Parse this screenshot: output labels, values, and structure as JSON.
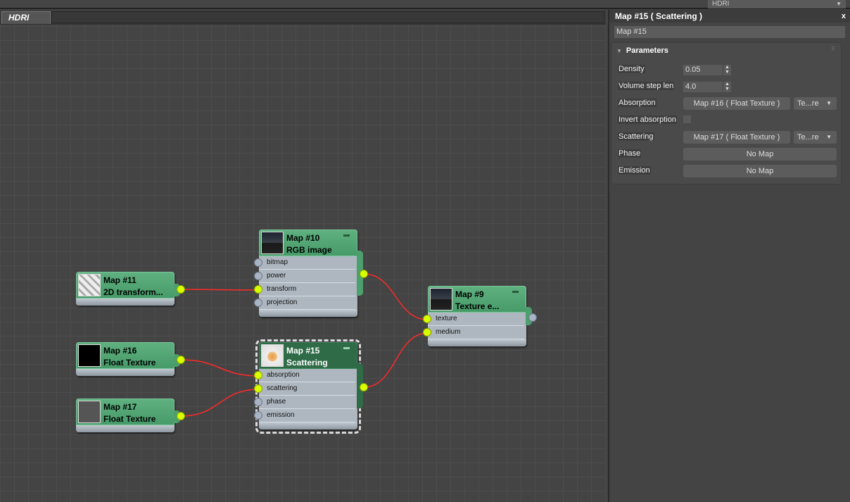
{
  "top_dropdown": {
    "value": "HDRI"
  },
  "view": {
    "tab": "HDRI"
  },
  "nodes": [
    {
      "id": "n11",
      "name": "Map #11",
      "type": "2D transform...",
      "thumb": "transform",
      "inputs": [],
      "output": "on"
    },
    {
      "id": "n10",
      "name": "Map #10",
      "type": "RGB image",
      "thumb": "hdri",
      "inputs": [
        {
          "label": "bitmap",
          "on": false
        },
        {
          "label": "power",
          "on": false
        },
        {
          "label": "transform",
          "on": true
        },
        {
          "label": "projection",
          "on": false
        }
      ],
      "output": "on"
    },
    {
      "id": "n9",
      "name": "Map #9",
      "type": "Texture e...",
      "thumb": "hdri",
      "inputs": [
        {
          "label": "texture",
          "on": true
        },
        {
          "label": "medium",
          "on": true
        }
      ],
      "output": "off"
    },
    {
      "id": "n16",
      "name": "Map #16",
      "type": "Float Texture",
      "thumb": "black",
      "inputs": [],
      "output": "on"
    },
    {
      "id": "n17",
      "name": "Map #17",
      "type": "Float Texture",
      "thumb": "gray",
      "inputs": [],
      "output": "on"
    },
    {
      "id": "n15",
      "name": "Map #15",
      "type": "Scattering",
      "thumb": "sphere",
      "selected": true,
      "inputs": [
        {
          "label": "absorption",
          "on": true
        },
        {
          "label": "scattering",
          "on": true
        },
        {
          "label": "phase",
          "on": false
        },
        {
          "label": "emission",
          "on": false
        }
      ],
      "output": "on"
    }
  ],
  "wires": [
    [
      "n11",
      "n10",
      "transform"
    ],
    [
      "n10",
      "n9",
      "texture"
    ],
    [
      "n16",
      "n15",
      "absorption"
    ],
    [
      "n17",
      "n15",
      "scattering"
    ],
    [
      "n15",
      "n9",
      "medium"
    ]
  ],
  "wire_color": "#ff2a2a",
  "panel": {
    "title": "Map #15  ( Scattering )",
    "close": "x",
    "name_field": "Map #15",
    "rollout": "Parameters",
    "density_label": "Density",
    "density": "0.05",
    "step_label": "Volume step len",
    "step": "4.0",
    "absorption_label": "Absorption",
    "absorption_map": "Map #16  ( Float Texture )",
    "absorption_dd": "Te...re",
    "invert_label": "Invert absorption",
    "scattering_label": "Scattering",
    "scattering_map": "Map #17  ( Float Texture )",
    "scattering_dd": "Te...re",
    "phase_label": "Phase",
    "phase_map": "No Map",
    "emission_label": "Emission",
    "emission_map": "No Map"
  }
}
